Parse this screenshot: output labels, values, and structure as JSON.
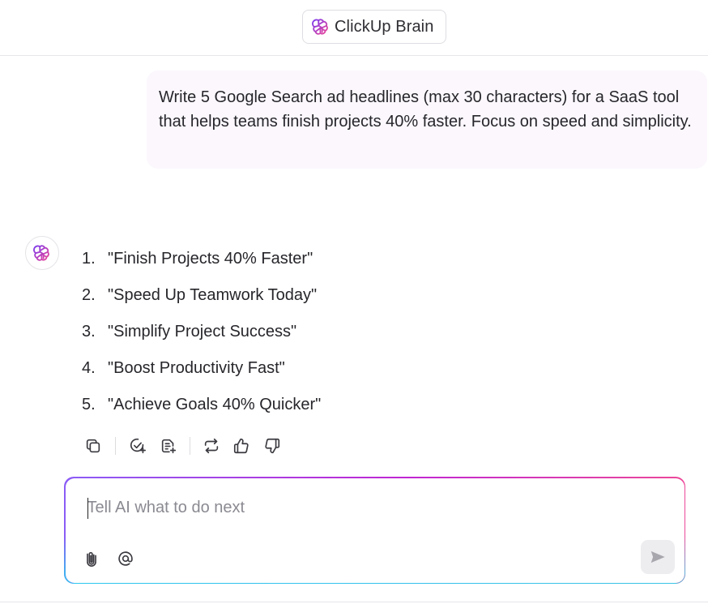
{
  "app": {
    "title": "ClickUp Brain",
    "icon": "clickup-brain-icon",
    "accent_colors": [
      "#7c3aed",
      "#c026d3",
      "#ec4899",
      "#22d3ee"
    ]
  },
  "conversation": {
    "user_message": "Write 5 Google Search ad headlines (max 30 characters) for a SaaS tool that helps teams finish projects 40% faster. Focus on speed and simplicity.",
    "assistant": {
      "avatar_icon": "clickup-brain-icon",
      "headlines": [
        {
          "number": "1.",
          "text": "\"Finish Projects 40% Faster\""
        },
        {
          "number": "2.",
          "text": "\"Speed Up Teamwork Today\""
        },
        {
          "number": "3.",
          "text": "\"Simplify Project Success\""
        },
        {
          "number": "4.",
          "text": "\"Boost Productivity Fast\""
        },
        {
          "number": "5.",
          "text": "\"Achieve Goals 40% Quicker\""
        }
      ],
      "actions": [
        "copy-icon",
        "create-task-icon",
        "add-to-doc-icon",
        "regenerate-icon",
        "thumbs-up-icon",
        "thumbs-down-icon"
      ]
    }
  },
  "composer": {
    "placeholder": "Tell AI what to do next",
    "value": "",
    "icons": [
      "paperclip-icon",
      "at-mention-icon",
      "send-icon"
    ]
  }
}
